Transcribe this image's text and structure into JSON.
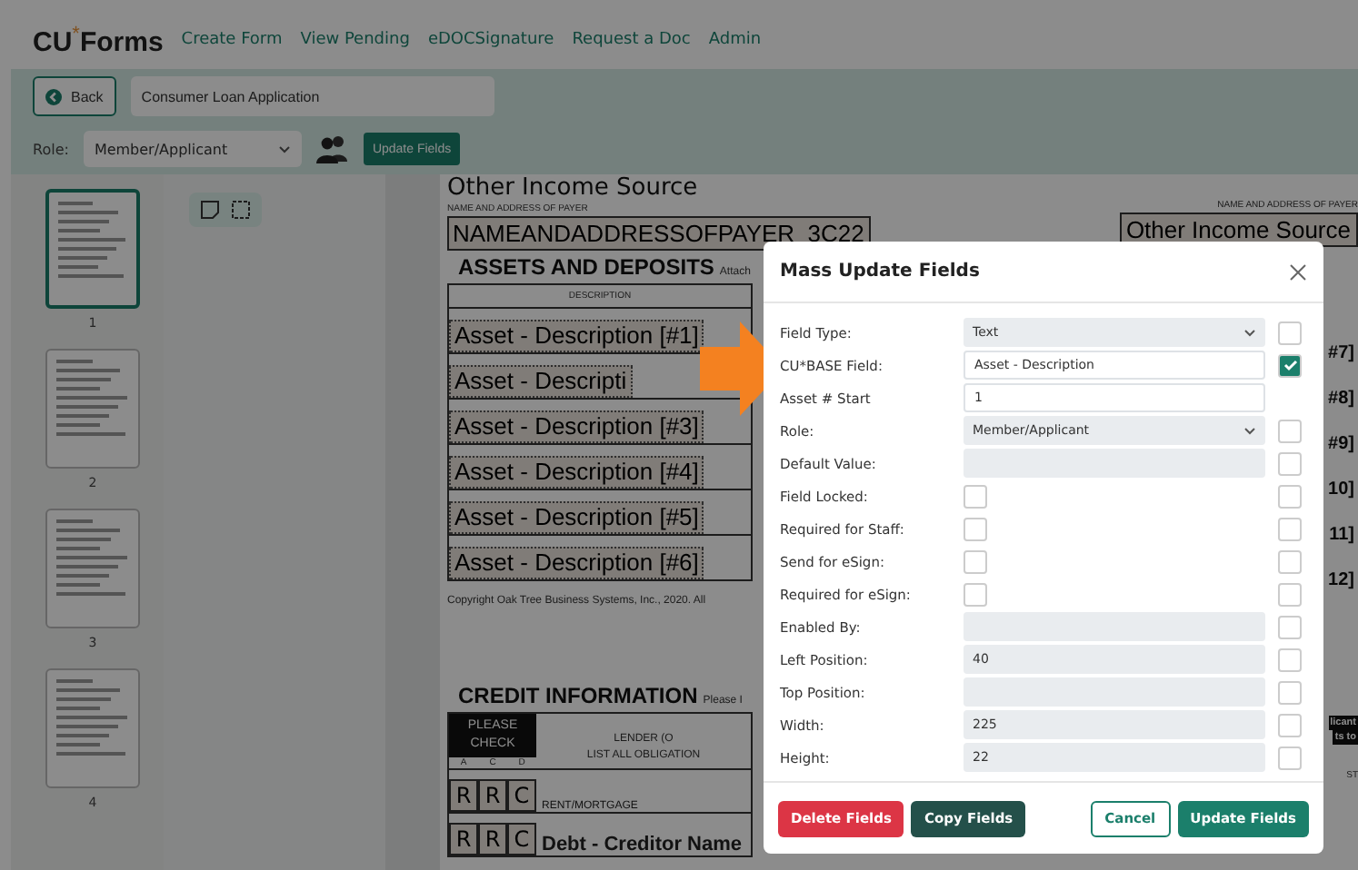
{
  "header": {
    "logo": {
      "left": "CU",
      "star": "*",
      "right": "Forms"
    },
    "nav": [
      "Create Form",
      "View Pending",
      "eDOCSignature",
      "Request a Doc",
      "Admin"
    ]
  },
  "toolbar": {
    "back": "Back",
    "document_title": "Consumer Loan Application",
    "role_label": "Role:",
    "role_value": "Member/Applicant",
    "update_button": "Update Fields"
  },
  "pages": [
    {
      "number": "1",
      "selected": true
    },
    {
      "number": "2",
      "selected": false
    },
    {
      "number": "3",
      "selected": false
    },
    {
      "number": "4",
      "selected": false
    }
  ],
  "document": {
    "top_heading": "Other Income Source",
    "payer_caption": "NAME AND ADDRESS OF PAYER",
    "payer_field": "NAMEANDADDRESSOFPAYER_3C22",
    "right_payer_caption": "NAME AND ADDRESS OF PAYER",
    "right_payer_field": "Other Income Source",
    "section": "ASSETS AND DEPOSITS",
    "section_note": "Attach",
    "column": "DESCRIPTION",
    "assets": [
      "Asset - Description [#1]",
      "Asset - Descripti",
      "Asset - Description [#3]",
      "Asset - Description [#4]",
      "Asset - Description [#5]",
      "Asset - Description [#6]"
    ],
    "right_assets": [
      "#7]",
      "#8]",
      "#9]",
      "10]",
      "11]",
      "12]"
    ],
    "copyright": "Copyright Oak Tree Business Systems, Inc., 2020. All",
    "credit_heading": "CREDIT INFORMATION",
    "credit_note": "Please I",
    "check_header": "PLEASE CHECK",
    "check_columns": [
      "A",
      "C",
      "D"
    ],
    "lender_header": [
      "LENDER (O",
      "LIST ALL OBLIGATION"
    ],
    "credit_rows": [
      {
        "marks": [
          "R",
          "R",
          "C"
        ],
        "label": "RENT/MORTGAGE"
      },
      {
        "marks": [
          "R",
          "R",
          "C"
        ],
        "label": "Debt - Creditor Name"
      }
    ],
    "right_fragments": [
      "licant",
      "ts to",
      "ST"
    ]
  },
  "modal": {
    "title": "Mass Update Fields",
    "fields": [
      {
        "label": "Field Type:",
        "kind": "select",
        "value": "Text",
        "apply": false
      },
      {
        "label": "CU*BASE Field:",
        "kind": "input",
        "value": "Asset - Description",
        "apply": true
      },
      {
        "label": "Asset # Start",
        "kind": "input",
        "value": "1"
      },
      {
        "label": "Role:",
        "kind": "select",
        "value": "Member/Applicant",
        "apply": false
      },
      {
        "label": "Default Value:",
        "kind": "readonly",
        "apply": false
      },
      {
        "label": "Field Locked:",
        "kind": "checkbox",
        "checked": false,
        "apply": false
      },
      {
        "label": "Required for Staff:",
        "kind": "checkbox",
        "checked": false,
        "apply": false
      },
      {
        "label": "Send for eSign:",
        "kind": "checkbox",
        "checked": false,
        "apply": false
      },
      {
        "label": "Required for eSign:",
        "kind": "checkbox",
        "checked": false,
        "apply": false
      },
      {
        "label": "Enabled By:",
        "kind": "readonly",
        "apply": false
      },
      {
        "label": "Left Position:",
        "kind": "readonly",
        "value": "40",
        "apply": false
      },
      {
        "label": "Top Position:",
        "kind": "readonly",
        "apply": false
      },
      {
        "label": "Width:",
        "kind": "readonly",
        "value": "225",
        "apply": false
      },
      {
        "label": "Height:",
        "kind": "readonly",
        "value": "22",
        "apply": false
      }
    ],
    "buttons": [
      {
        "label": "Delete Fields",
        "kind": "danger"
      },
      {
        "label": "Copy Fields",
        "kind": "dark"
      },
      {
        "label": "Cancel",
        "kind": "outline"
      },
      {
        "label": "Update Fields",
        "kind": "primary"
      }
    ]
  }
}
